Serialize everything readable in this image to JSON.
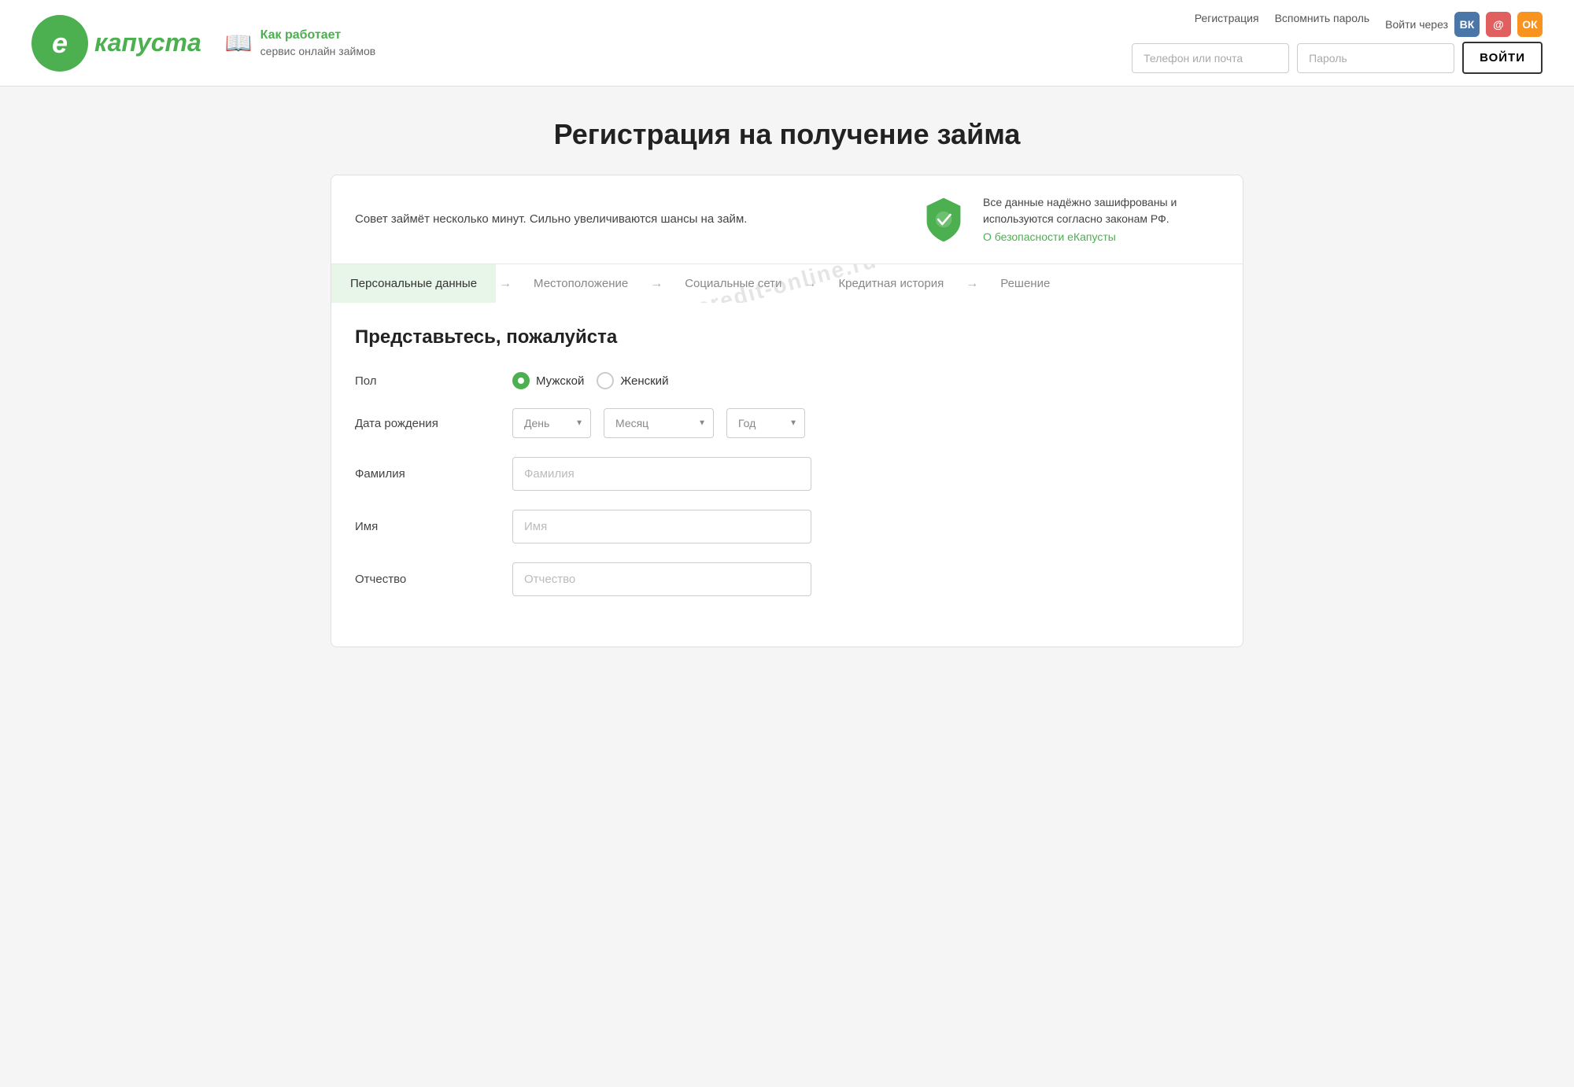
{
  "header": {
    "logo_letter": "e",
    "logo_name": "капуста",
    "how_works_link": "Как работает",
    "how_works_sub": "сервис онлайн займов",
    "auth_links": {
      "register": "Регистрация",
      "forgot_password": "Вспомнить пароль"
    },
    "social_login_label": "Войти через",
    "phone_placeholder": "Телефон или почта",
    "password_placeholder": "Пароль",
    "login_button": "ВОЙТИ"
  },
  "page": {
    "title": "Регистрация на получение займа"
  },
  "info_banner": {
    "left_text": "Совет займёт несколько минут. Сильно увеличиваются шансы на займ.",
    "right_text": "Все данные надёжно зашифрованы и используются согласно законам РФ.",
    "security_link": "О безопасности еКапусты"
  },
  "steps": [
    {
      "label": "Персональные данные",
      "active": true
    },
    {
      "label": "Местоположение",
      "active": false
    },
    {
      "label": "Социальные сети",
      "active": false
    },
    {
      "label": "Кредитная история",
      "active": false
    },
    {
      "label": "Решение",
      "active": false
    }
  ],
  "watermark": "credit-online.ru",
  "form": {
    "subtitle": "Представьтесь, пожалуйста",
    "gender_label": "Пол",
    "gender_male": "Мужской",
    "gender_female": "Женский",
    "birthdate_label": "Дата рождения",
    "day_placeholder": "День",
    "month_placeholder": "Месяц",
    "year_placeholder": "Год",
    "surname_label": "Фамилия",
    "surname_placeholder": "Фамилия",
    "name_label": "Имя",
    "name_placeholder": "Имя",
    "patronymic_label": "Отчество",
    "patronymic_placeholder": "Отчество"
  }
}
